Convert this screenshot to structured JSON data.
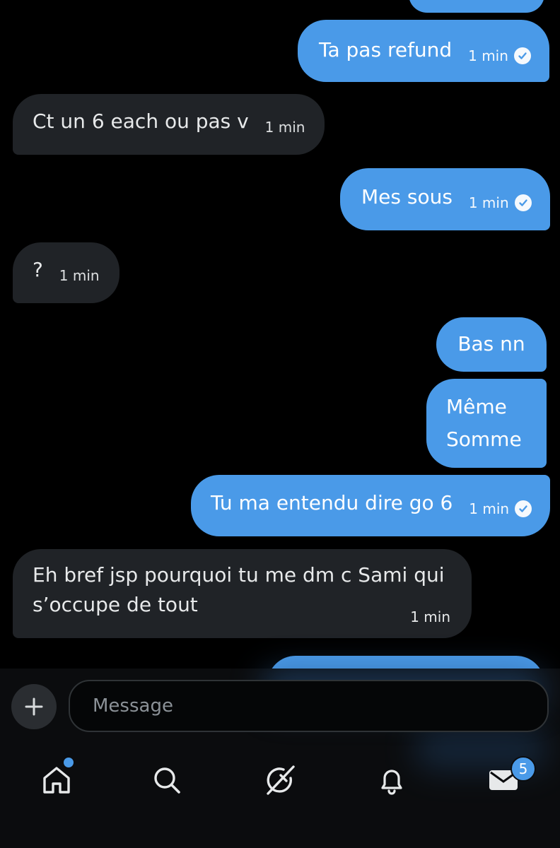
{
  "conversation": {
    "messages": [
      {
        "direction": "outgoing",
        "text": "Ta pas refund",
        "time": "1 min",
        "read": true
      },
      {
        "direction": "incoming",
        "text": "Ct un 6 each ou pas v",
        "time": "1 min"
      },
      {
        "direction": "outgoing",
        "text": "Mes sous",
        "time": "1 min",
        "read": true
      },
      {
        "direction": "incoming",
        "text": "?",
        "time": "1 min"
      },
      {
        "direction": "outgoing",
        "text": "Bas nn"
      },
      {
        "direction": "outgoing",
        "lines": [
          "Même",
          "Somme"
        ]
      },
      {
        "direction": "outgoing",
        "text": "Tu ma entendu dire go 6",
        "time": "1 min",
        "read": true
      },
      {
        "direction": "incoming",
        "lines": [
          "Eh bref jsp pourquoi tu me dm c Sami qui",
          "s’occupe de tout"
        ],
        "time": "1 min"
      }
    ]
  },
  "composer": {
    "placeholder": "Message"
  },
  "bottom_nav": {
    "items": [
      "home-icon",
      "search-icon",
      "grok-icon",
      "notifications-icon",
      "messages-icon"
    ],
    "messages_badge": "5"
  },
  "colors": {
    "outgoing_bubble": "#4a9ae8",
    "incoming_bubble": "#202327",
    "background": "#000000"
  }
}
